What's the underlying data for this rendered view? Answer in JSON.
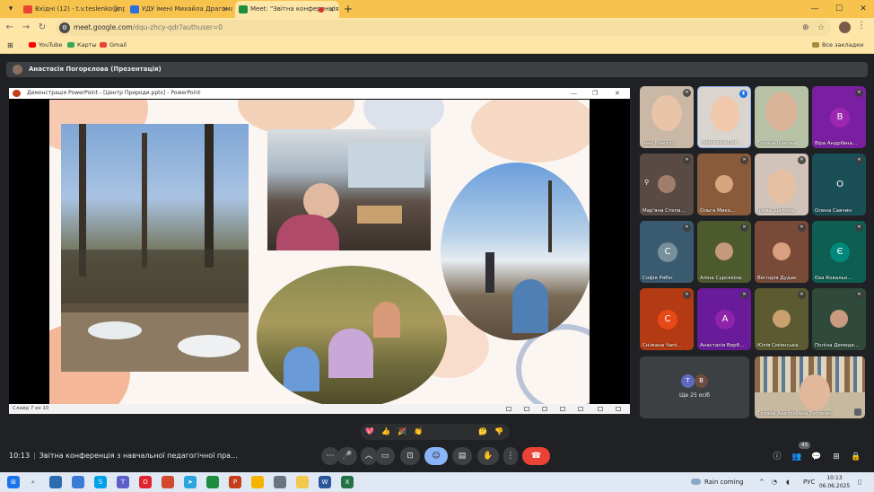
{
  "browser": {
    "tabs": [
      {
        "label": "Вхідні (12) - t.v.teslenko@npu.edu.ua",
        "favicon_color": "#ea4335",
        "active": false
      },
      {
        "label": "УДУ імені Михайла Драгоманова",
        "favicon_color": "#2a6fdb",
        "active": false
      },
      {
        "label": "Meet: \"Звітна конференція",
        "favicon_color": "#1e8e3e",
        "active": true
      }
    ],
    "new_tab": "+",
    "url_host": "meet.google.com",
    "url_path": "/dqu-zhcy-qdr?authuser=0",
    "bookmarks": [
      {
        "label": "YouTube",
        "color": "#ff0000"
      },
      {
        "label": "Карты",
        "color": "#34a853"
      },
      {
        "label": "Gmail",
        "color": "#ea4335"
      }
    ],
    "all_bookmarks": "Все закладки"
  },
  "meet": {
    "presenter_label": "Анастасія Погорєлова (Презентація)",
    "ppt_window_title": "Демонстрація PowerPoint - [Центр Природи.pptx] - PowerPoint",
    "slide_counter": "Слайд 7 из 10",
    "participants": [
      {
        "name": "Інна Микол...",
        "type": "video",
        "bg": "#c9b8a6",
        "face": "#e8c4a8",
        "mic": "muted"
      },
      {
        "name": "Анастасія Пог...",
        "type": "video",
        "bg": "#dad4cf",
        "face": "#f0c8ac",
        "mic": "talk"
      },
      {
        "name": "Тетяна Ісакова",
        "type": "video",
        "bg": "#b7c1a6",
        "face": "#d9b499",
        "mic": "muted"
      },
      {
        "name": "Віра Андріївна...",
        "type": "letter",
        "letter": "В",
        "bg": "#7b1fa2",
        "avatar": "#9c27b0",
        "mic": "muted"
      },
      {
        "name": "Мар'яна Степа...",
        "type": "small",
        "bg": "#5a4a44",
        "face": "#a07e6a",
        "mic": "muted",
        "pinned": true
      },
      {
        "name": "Ольга Мико...",
        "type": "small",
        "bg": "#8a5b3a",
        "face": "#d8a57e",
        "mic": "muted"
      },
      {
        "name": "Ірина Шапова...",
        "type": "video",
        "bg": "#d1c3b9",
        "face": "#e6c0a2",
        "mic": "muted"
      },
      {
        "name": "Олена Савчин",
        "type": "letter",
        "letter": "О",
        "bg": "#1b4f57",
        "avatar": "#1b4f57",
        "mic": "muted"
      },
      {
        "name": "Софія Рябін",
        "type": "letter",
        "letter": "С",
        "bg": "#3a5a70",
        "avatar": "#78909c",
        "mic": "muted"
      },
      {
        "name": "Аліна Сурсякіна",
        "type": "small",
        "bg": "#4d5a2e",
        "face": "#c49a7a",
        "mic": "muted"
      },
      {
        "name": "Вікторія Дудак",
        "type": "small",
        "bg": "#7a4a38",
        "face": "#d8a080",
        "mic": "muted"
      },
      {
        "name": "Єва Ковальо...",
        "type": "letter",
        "letter": "Є",
        "bg": "#0f5e52",
        "avatar": "#00897b",
        "mic": "muted"
      },
      {
        "name": "Сніжана Чапі...",
        "type": "letter",
        "letter": "С",
        "bg": "#b33a12",
        "avatar": "#e64a19",
        "mic": "muted"
      },
      {
        "name": "Анастасія Верб...",
        "type": "letter",
        "letter": "А",
        "bg": "#6a1b9a",
        "avatar": "#8e24aa",
        "mic": "muted"
      },
      {
        "name": "Юлія Сміянська",
        "type": "small",
        "bg": "#5b5a30",
        "face": "#caa070",
        "mic": "muted"
      },
      {
        "name": "Поліна Демиде...",
        "type": "small",
        "bg": "#2f4a3a",
        "face": "#c99a80",
        "mic": "muted"
      }
    ],
    "others": {
      "text": "Ще 25 осіб",
      "avatars": [
        {
          "letter": "Т",
          "color": "#5c6bc0"
        },
        {
          "letter": "В",
          "color": "#6d4c41"
        }
      ]
    },
    "self_tile": {
      "name": "Тетяна Анатоліївна Тесленко",
      "bg": "#c7b9a0"
    },
    "reactions": [
      "💖",
      "👍",
      "🎉",
      "👏",
      "😂",
      "😮",
      "😢",
      "🤔",
      "👎"
    ],
    "meeting_time": "10:13",
    "meeting_title": "Звітна конференція з навчальної педагогічної пра...",
    "people_count": "43"
  },
  "taskbar": {
    "weather": "Rain coming",
    "lang": "РУС",
    "time": "10:13",
    "date": "06.06.2025"
  }
}
